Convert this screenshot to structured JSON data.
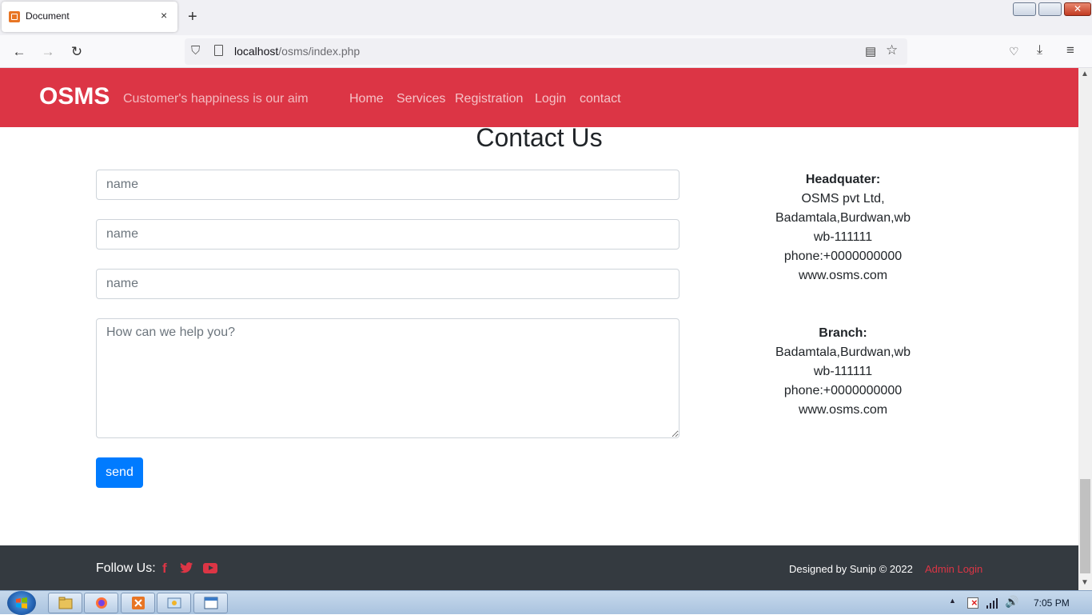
{
  "browser": {
    "tab_title": "Document",
    "tab_close": "×",
    "new_tab": "+",
    "url_host": "localhost",
    "url_path": "/osms/index.php",
    "window_close": "✕"
  },
  "site": {
    "brand": "OSMS",
    "tagline": "Customer's happiness is our aim",
    "nav": [
      "Home",
      "Services",
      "Registration",
      "Login",
      "contact"
    ],
    "accent_color": "#dc3545"
  },
  "contact": {
    "heading": "Contact Us",
    "fields": [
      {
        "placeholder": "name"
      },
      {
        "placeholder": "name"
      },
      {
        "placeholder": "name"
      }
    ],
    "message_placeholder": "How can we help you?",
    "send_label": "send",
    "send_color": "#007bff"
  },
  "addresses": {
    "headquarter": {
      "title": "Headquater:",
      "lines": [
        "OSMS pvt Ltd,",
        "Badamtala,Burdwan,wb",
        "wb-111111",
        "phone:+0000000000",
        "www.osms.com"
      ]
    },
    "branch": {
      "title": "Branch:",
      "lines": [
        "Badamtala,Burdwan,wb",
        "wb-111111",
        "phone:+0000000000",
        "www.osms.com"
      ]
    }
  },
  "footer": {
    "follow_label": "Follow Us:",
    "facebook_glyph": "f",
    "designed_by": "Designed by Sunip © 2022",
    "admin_login": "Admin Login",
    "icons": [
      "facebook-icon",
      "twitter-icon",
      "youtube-icon"
    ]
  },
  "taskbar": {
    "clock": "7:05 PM"
  }
}
